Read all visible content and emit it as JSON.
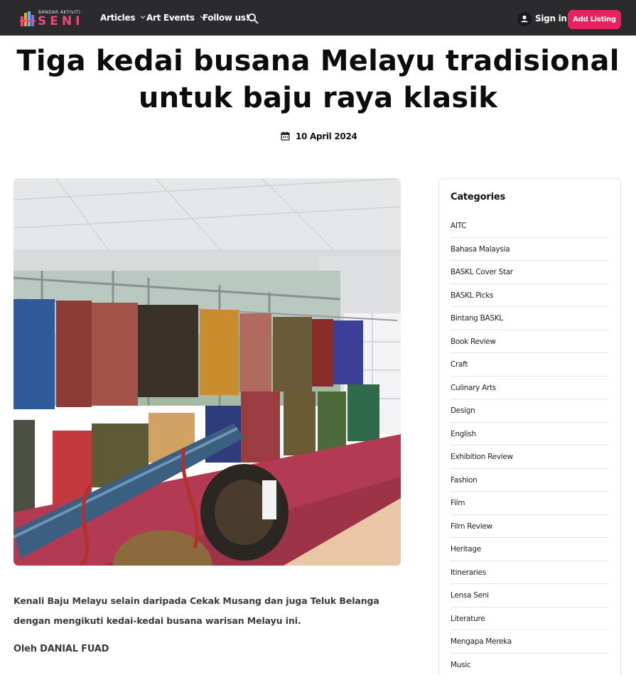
{
  "logo": {
    "small_text": "BANDAR AKTIVITI",
    "big_text": "SENI"
  },
  "nav": {
    "articles": "Articles",
    "art_events": "Art Events",
    "follow": "Follow us!",
    "sign_in": "Sign in",
    "add_listing": "Add Listing"
  },
  "icons": {
    "search": "search-icon",
    "user": "user-icon",
    "calendar": "calendar-icon",
    "caret": "chevron-down-icon"
  },
  "colors": {
    "navbar_bg": "#2b2b2d",
    "accent": "#e8215f"
  },
  "article": {
    "title": "Tiga kedai busana Melayu tradisional untuk baju raya klasik",
    "date": "10 April 2024",
    "lead": "Kenali Baju Melayu selain daripada Cekak Musang dan juga Teluk Belanga dengan mengikuti kedai-kedai busana warisan Melayu ini.",
    "byline": "Oleh DANIAL FUAD"
  },
  "sidebar": {
    "title": "Categories",
    "categories": [
      "AITC",
      "Bahasa Malaysia",
      "BASKL Cover Star",
      "BASKL Picks",
      "Bintang BASKL",
      "Book Review",
      "Craft",
      "Culinary Arts",
      "Design",
      "English",
      "Exhibition Review",
      "Fashion",
      "Film",
      "Film Review",
      "Heritage",
      "Itineraries",
      "Lensa Seni",
      "Literature",
      "Mengapa Mereka",
      "Music"
    ]
  }
}
